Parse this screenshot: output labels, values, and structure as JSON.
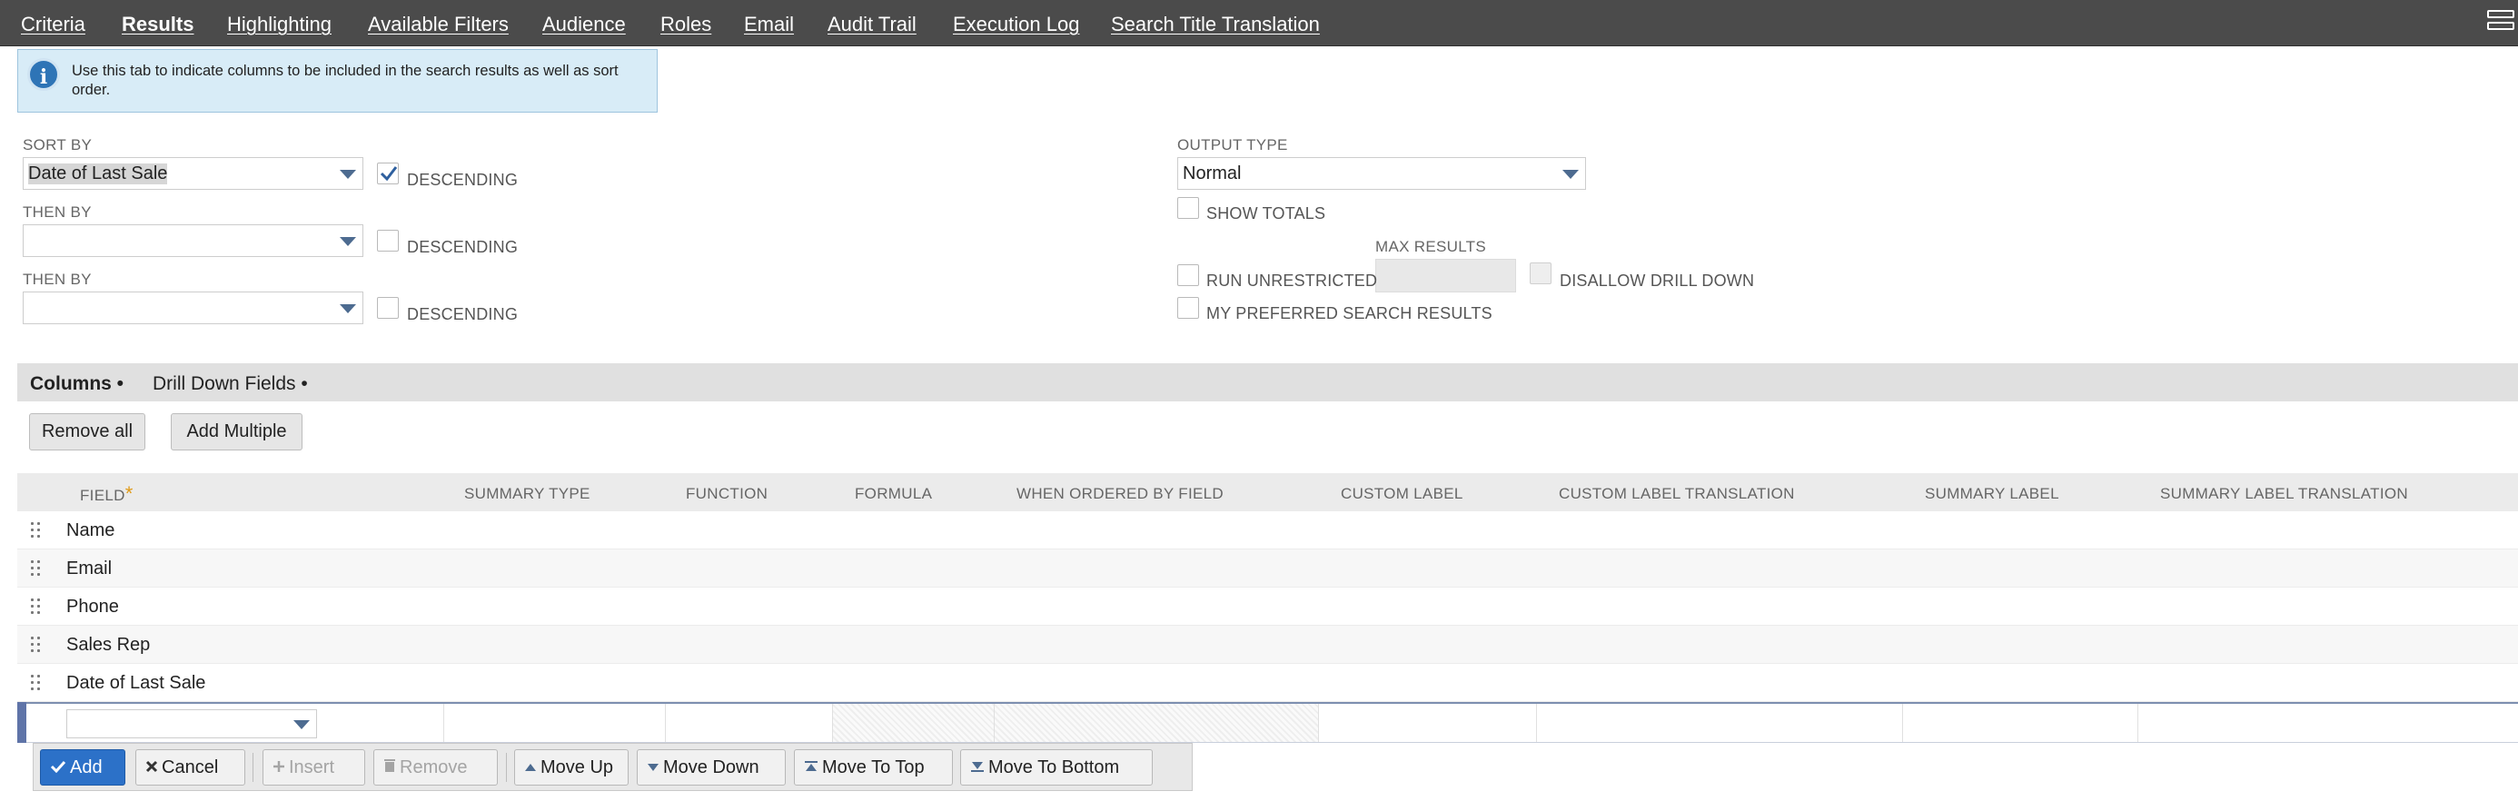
{
  "tabs": [
    {
      "label": "Criteria",
      "active": false
    },
    {
      "label": "Results",
      "active": true
    },
    {
      "label": "Highlighting",
      "active": false
    },
    {
      "label": "Available Filters",
      "active": false
    },
    {
      "label": "Audience",
      "active": false
    },
    {
      "label": "Roles",
      "active": false
    },
    {
      "label": "Email",
      "active": false
    },
    {
      "label": "Audit Trail",
      "active": false
    },
    {
      "label": "Execution Log",
      "active": false
    },
    {
      "label": "Search Title Translation",
      "active": false
    }
  ],
  "info": {
    "text": "Use this tab to indicate columns to be included in the search results as well as sort order."
  },
  "sort": {
    "sort_by_label": "SORT BY",
    "sort_by_value": "Date of Last Sale",
    "then_by_label_1": "THEN BY",
    "then_by_value_1": "",
    "then_by_label_2": "THEN BY",
    "then_by_value_2": "",
    "descending_label": "DESCENDING",
    "descending_checked": [
      true,
      false,
      false
    ]
  },
  "output": {
    "output_type_label": "OUTPUT TYPE",
    "output_type_value": "Normal",
    "show_totals_label": "SHOW TOTALS",
    "run_unrestricted_label": "RUN UNRESTRICTED",
    "max_results_label": "MAX RESULTS",
    "max_results_value": "",
    "disallow_drill_down_label": "DISALLOW DRILL DOWN",
    "preferred_label": "MY PREFERRED SEARCH RESULTS"
  },
  "subtabs": [
    {
      "label": "Columns •",
      "active": true
    },
    {
      "label": "Drill Down Fields •",
      "active": false
    }
  ],
  "buttons": {
    "remove_all": "Remove all",
    "add_multiple": "Add Multiple"
  },
  "table": {
    "columns": [
      "FIELD",
      "SUMMARY TYPE",
      "FUNCTION",
      "FORMULA",
      "WHEN ORDERED BY FIELD",
      "CUSTOM LABEL",
      "CUSTOM LABEL TRANSLATION",
      "SUMMARY LABEL",
      "SUMMARY LABEL TRANSLATION"
    ],
    "required_marker": "*",
    "rows": [
      "Name",
      "Email",
      "Phone",
      "Sales Rep",
      "Date of Last Sale"
    ]
  },
  "actions": {
    "add": "Add",
    "cancel": "Cancel",
    "insert": "Insert",
    "remove": "Remove",
    "move_up": "Move Up",
    "move_down": "Move Down",
    "move_to_top": "Move To Top",
    "move_to_bottom": "Move To Bottom"
  },
  "icons": {
    "info": "info-icon",
    "dropdown": "chevron-down-icon",
    "check": "check-icon",
    "menu": "menu-icon",
    "drag": "drag-handle-icon"
  },
  "colors": {
    "topbar": "#4b4b4b",
    "info_bg": "#d8ecf7",
    "info_icon": "#2e74b6",
    "primary_button": "#2c71c8",
    "required": "#e09a17"
  }
}
